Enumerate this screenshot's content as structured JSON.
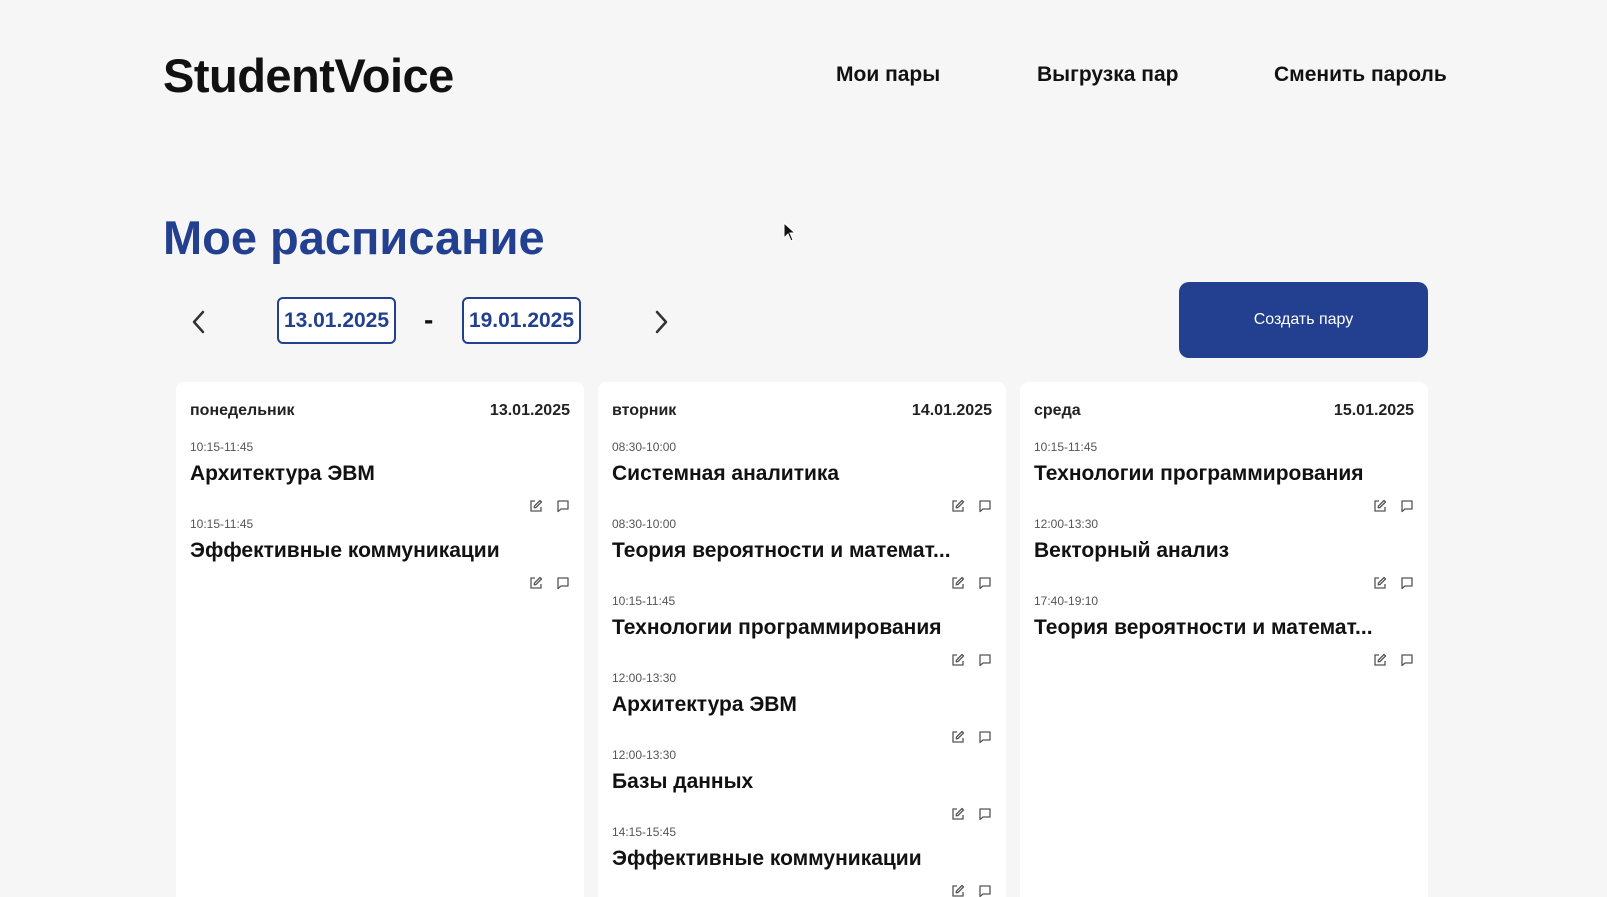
{
  "header": {
    "logo": "StudentVoice",
    "nav": [
      "Мои пары",
      "Выгрузка пар",
      "Сменить пароль"
    ]
  },
  "page_title": "Мое расписание",
  "week": {
    "from": "13.01.2025",
    "separator": "-",
    "to": "19.01.2025"
  },
  "create_button": "Создать пару",
  "colors": {
    "accent": "#22408f",
    "background": "#f6f6f6",
    "card": "#ffffff"
  },
  "icons": {
    "prev": "chevron-left-icon",
    "next": "chevron-right-icon",
    "edit": "edit-icon",
    "comment": "comment-icon"
  },
  "days": [
    {
      "name": "понедельник",
      "date": "13.01.2025",
      "lessons": [
        {
          "time": "10:15-11:45",
          "title": "Архитектура ЭВМ"
        },
        {
          "time": "10:15-11:45",
          "title": "Эффективные коммуникации"
        }
      ]
    },
    {
      "name": "вторник",
      "date": "14.01.2025",
      "lessons": [
        {
          "time": "08:30-10:00",
          "title": "Системная аналитика"
        },
        {
          "time": "08:30-10:00",
          "title": "Теория вероятности и математ..."
        },
        {
          "time": "10:15-11:45",
          "title": "Технологии программирования"
        },
        {
          "time": "12:00-13:30",
          "title": "Архитектура ЭВМ"
        },
        {
          "time": "12:00-13:30",
          "title": "Базы данных"
        },
        {
          "time": "14:15-15:45",
          "title": "Эффективные коммуникации"
        }
      ]
    },
    {
      "name": "среда",
      "date": "15.01.2025",
      "lessons": [
        {
          "time": "10:15-11:45",
          "title": "Технологии программирования"
        },
        {
          "time": "12:00-13:30",
          "title": "Векторный анализ"
        },
        {
          "time": "17:40-19:10",
          "title": "Теория вероятности и математ..."
        }
      ]
    }
  ]
}
